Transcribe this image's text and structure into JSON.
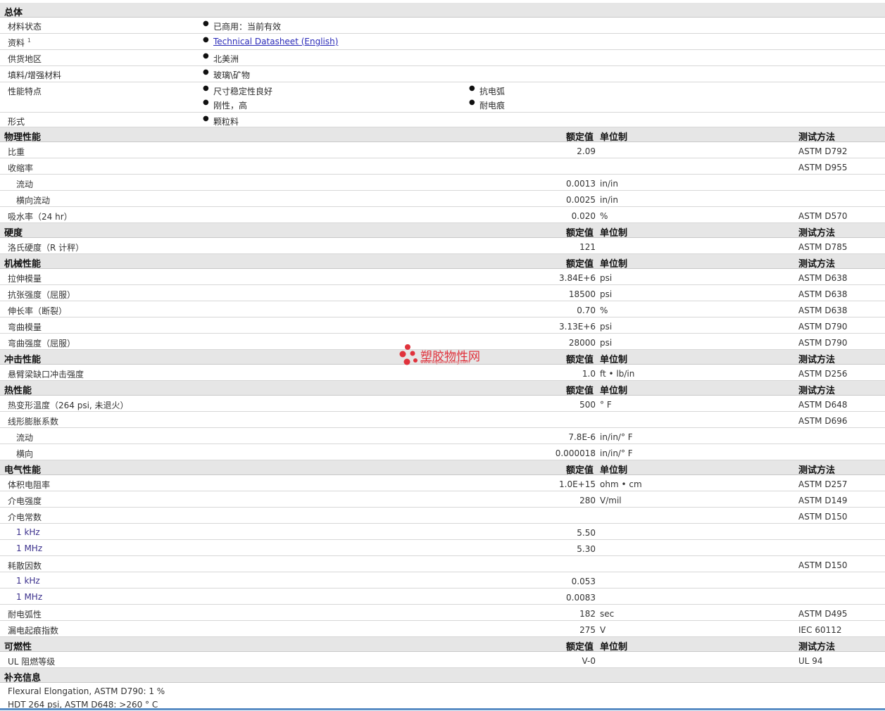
{
  "general": {
    "title": "总体",
    "rows": [
      {
        "label": "材料状态",
        "values": [
          "已商用：当前有效"
        ]
      },
      {
        "label": "资料",
        "sup": "1",
        "link": "Technical Datasheet (English)"
      },
      {
        "label": "供货地区",
        "values": [
          "北美洲"
        ]
      },
      {
        "label": "填料/增强材料",
        "values": [
          "玻璃\\矿物"
        ]
      },
      {
        "label": "性能特点",
        "values": [
          "尺寸稳定性良好",
          "抗电弧",
          "刚性，高",
          "耐电痕"
        ]
      },
      {
        "label": "形式",
        "values": [
          "颗粒料"
        ]
      }
    ]
  },
  "header_labels": {
    "nominal": "额定值",
    "unit": "单位制",
    "method": "测试方法"
  },
  "sections": [
    {
      "title": "物理性能",
      "rows": [
        {
          "label": "比重",
          "value": "2.09",
          "unit": "",
          "method": "ASTM D792"
        },
        {
          "label": "收缩率",
          "value": "",
          "unit": "",
          "method": "ASTM D955"
        },
        {
          "label": "流动",
          "sub": true,
          "value": "0.0013",
          "unit": "in/in",
          "method": ""
        },
        {
          "label": "横向流动",
          "sub": true,
          "value": "0.0025",
          "unit": "in/in",
          "method": ""
        },
        {
          "label": "吸水率（24 hr）",
          "value": "0.020",
          "unit": "%",
          "method": "ASTM D570"
        }
      ]
    },
    {
      "title": "硬度",
      "rows": [
        {
          "label": "洛氏硬度（R 计秤）",
          "value": "121",
          "unit": "",
          "method": "ASTM D785"
        }
      ]
    },
    {
      "title": "机械性能",
      "rows": [
        {
          "label": "拉伸模量",
          "value": "3.84E+6",
          "unit": "psi",
          "method": "ASTM D638"
        },
        {
          "label": "抗张强度（屈服）",
          "value": "18500",
          "unit": "psi",
          "method": "ASTM D638"
        },
        {
          "label": "伸长率（断裂）",
          "value": "0.70",
          "unit": "%",
          "method": "ASTM D638"
        },
        {
          "label": "弯曲模量",
          "value": "3.13E+6",
          "unit": "psi",
          "method": "ASTM D790"
        },
        {
          "label": "弯曲强度（屈服）",
          "value": "28000",
          "unit": "psi",
          "method": "ASTM D790"
        }
      ]
    },
    {
      "title": "冲击性能",
      "rows": [
        {
          "label": "悬臂梁缺口冲击强度",
          "value": "1.0",
          "unit": "ft • lb/in",
          "method": "ASTM D256"
        }
      ]
    },
    {
      "title": "热性能",
      "rows": [
        {
          "label": "热变形温度（264 psi, 未退火）",
          "value": "500",
          "unit": "° F",
          "method": "ASTM D648"
        },
        {
          "label": "线形膨胀系数",
          "value": "",
          "unit": "",
          "method": "ASTM D696"
        },
        {
          "label": "流动",
          "sub": true,
          "value": "7.8E-6",
          "unit": "in/in/° F",
          "method": ""
        },
        {
          "label": "横向",
          "sub": true,
          "value": "0.000018",
          "unit": "in/in/° F",
          "method": ""
        }
      ]
    },
    {
      "title": "电气性能",
      "rows": [
        {
          "label": "体积电阻率",
          "value": "1.0E+15",
          "unit": "ohm • cm",
          "method": "ASTM D257"
        },
        {
          "label": "介电强度",
          "value": "280",
          "unit": "V/mil",
          "method": "ASTM D149"
        },
        {
          "label": "介电常数",
          "value": "",
          "unit": "",
          "method": "ASTM D150"
        },
        {
          "label": "1 kHz",
          "sub": true,
          "blue": true,
          "value": "5.50",
          "unit": "",
          "method": ""
        },
        {
          "label": "1 MHz",
          "sub": true,
          "blue": true,
          "value": "5.30",
          "unit": "",
          "method": ""
        },
        {
          "label": "耗散因数",
          "value": "",
          "unit": "",
          "method": "ASTM D150"
        },
        {
          "label": "1 kHz",
          "sub": true,
          "blue": true,
          "value": "0.053",
          "unit": "",
          "method": ""
        },
        {
          "label": "1 MHz",
          "sub": true,
          "blue": true,
          "value": "0.0083",
          "unit": "",
          "method": ""
        },
        {
          "label": "耐电弧性",
          "value": "182",
          "unit": "sec",
          "method": "ASTM D495"
        },
        {
          "label": "漏电起痕指数",
          "value": "275",
          "unit": "V",
          "method": "IEC 60112"
        }
      ]
    },
    {
      "title": "可燃性",
      "rows": [
        {
          "label": "UL 阻燃等级",
          "value": "V-0",
          "unit": "",
          "method": "UL 94"
        }
      ]
    }
  ],
  "supplement": {
    "title": "补充信息",
    "notes": [
      "Flexural Elongation, ASTM D790: 1 %",
      "HDT 264 psi, ASTM D648: >260 °  C"
    ]
  },
  "watermark": {
    "name": "塑胶物性网",
    "url": "www.sujiaowuxing.com",
    "color": "#e0323c"
  }
}
